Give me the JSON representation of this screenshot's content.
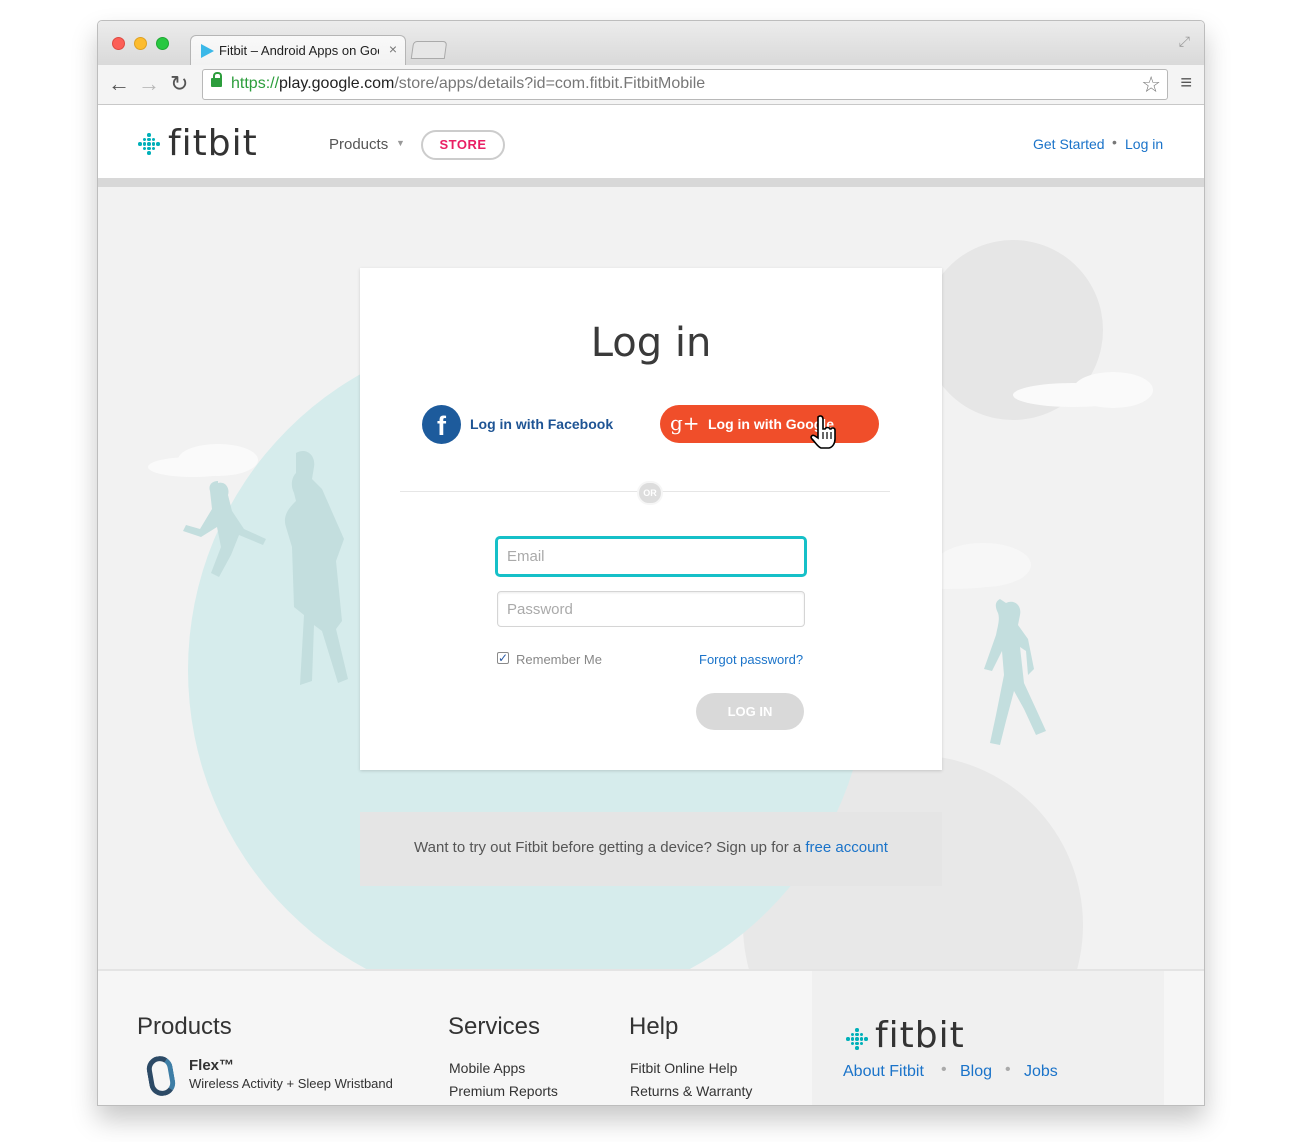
{
  "browser": {
    "tab_title": "Fitbit – Android Apps on Google Play",
    "tab_close": "×",
    "url_scheme": "https://",
    "url_host": "play.google.com",
    "url_path": "/store/apps/details?id=com.fitbit.FitbitMobile"
  },
  "header": {
    "logo_text": "fitbit",
    "nav_products": "Products",
    "store_label": "STORE",
    "get_started": "Get Started",
    "separator": "•",
    "login_link": "Log in"
  },
  "login": {
    "title": "Log in",
    "facebook_label": "Log in with Facebook",
    "google_label": "Log in with Google",
    "or_label": "OR",
    "email_placeholder": "Email",
    "password_placeholder": "Password",
    "remember_label": "Remember Me",
    "remember_checked": true,
    "forgot_label": "Forgot password?",
    "submit_label": "LOG IN"
  },
  "signup": {
    "text": "Want to try out Fitbit before getting a device? Sign up for a ",
    "link": "free account"
  },
  "footer": {
    "products_title": "Products",
    "flex_name": "Flex™",
    "flex_desc": "Wireless Activity + Sleep Wristband",
    "services_title": "Services",
    "services_items": [
      "Mobile Apps",
      "Premium Reports"
    ],
    "help_title": "Help",
    "help_items": [
      "Fitbit Online Help",
      "Returns & Warranty"
    ],
    "logo_text": "fitbit",
    "links": [
      "About Fitbit",
      "Blog",
      "Jobs"
    ],
    "separator": "•"
  },
  "colors": {
    "accent_teal": "#00b0b9",
    "facebook_blue": "#1d5b9c",
    "google_red": "#f04e2a",
    "store_pink": "#e91e63",
    "link_blue": "#1a73c9"
  }
}
